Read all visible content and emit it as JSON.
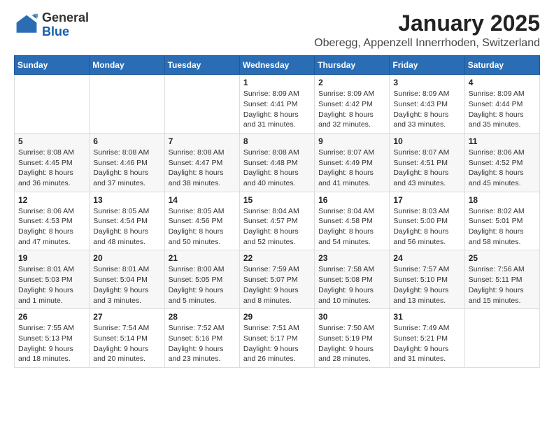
{
  "logo": {
    "general": "General",
    "blue": "Blue"
  },
  "header": {
    "month": "January 2025",
    "location": "Oberegg, Appenzell Innerrhoden, Switzerland"
  },
  "weekdays": [
    "Sunday",
    "Monday",
    "Tuesday",
    "Wednesday",
    "Thursday",
    "Friday",
    "Saturday"
  ],
  "weeks": [
    [
      {
        "day": "",
        "info": ""
      },
      {
        "day": "",
        "info": ""
      },
      {
        "day": "",
        "info": ""
      },
      {
        "day": "1",
        "info": "Sunrise: 8:09 AM\nSunset: 4:41 PM\nDaylight: 8 hours and 31 minutes."
      },
      {
        "day": "2",
        "info": "Sunrise: 8:09 AM\nSunset: 4:42 PM\nDaylight: 8 hours and 32 minutes."
      },
      {
        "day": "3",
        "info": "Sunrise: 8:09 AM\nSunset: 4:43 PM\nDaylight: 8 hours and 33 minutes."
      },
      {
        "day": "4",
        "info": "Sunrise: 8:09 AM\nSunset: 4:44 PM\nDaylight: 8 hours and 35 minutes."
      }
    ],
    [
      {
        "day": "5",
        "info": "Sunrise: 8:08 AM\nSunset: 4:45 PM\nDaylight: 8 hours and 36 minutes."
      },
      {
        "day": "6",
        "info": "Sunrise: 8:08 AM\nSunset: 4:46 PM\nDaylight: 8 hours and 37 minutes."
      },
      {
        "day": "7",
        "info": "Sunrise: 8:08 AM\nSunset: 4:47 PM\nDaylight: 8 hours and 38 minutes."
      },
      {
        "day": "8",
        "info": "Sunrise: 8:08 AM\nSunset: 4:48 PM\nDaylight: 8 hours and 40 minutes."
      },
      {
        "day": "9",
        "info": "Sunrise: 8:07 AM\nSunset: 4:49 PM\nDaylight: 8 hours and 41 minutes."
      },
      {
        "day": "10",
        "info": "Sunrise: 8:07 AM\nSunset: 4:51 PM\nDaylight: 8 hours and 43 minutes."
      },
      {
        "day": "11",
        "info": "Sunrise: 8:06 AM\nSunset: 4:52 PM\nDaylight: 8 hours and 45 minutes."
      }
    ],
    [
      {
        "day": "12",
        "info": "Sunrise: 8:06 AM\nSunset: 4:53 PM\nDaylight: 8 hours and 47 minutes."
      },
      {
        "day": "13",
        "info": "Sunrise: 8:05 AM\nSunset: 4:54 PM\nDaylight: 8 hours and 48 minutes."
      },
      {
        "day": "14",
        "info": "Sunrise: 8:05 AM\nSunset: 4:56 PM\nDaylight: 8 hours and 50 minutes."
      },
      {
        "day": "15",
        "info": "Sunrise: 8:04 AM\nSunset: 4:57 PM\nDaylight: 8 hours and 52 minutes."
      },
      {
        "day": "16",
        "info": "Sunrise: 8:04 AM\nSunset: 4:58 PM\nDaylight: 8 hours and 54 minutes."
      },
      {
        "day": "17",
        "info": "Sunrise: 8:03 AM\nSunset: 5:00 PM\nDaylight: 8 hours and 56 minutes."
      },
      {
        "day": "18",
        "info": "Sunrise: 8:02 AM\nSunset: 5:01 PM\nDaylight: 8 hours and 58 minutes."
      }
    ],
    [
      {
        "day": "19",
        "info": "Sunrise: 8:01 AM\nSunset: 5:03 PM\nDaylight: 9 hours and 1 minute."
      },
      {
        "day": "20",
        "info": "Sunrise: 8:01 AM\nSunset: 5:04 PM\nDaylight: 9 hours and 3 minutes."
      },
      {
        "day": "21",
        "info": "Sunrise: 8:00 AM\nSunset: 5:05 PM\nDaylight: 9 hours and 5 minutes."
      },
      {
        "day": "22",
        "info": "Sunrise: 7:59 AM\nSunset: 5:07 PM\nDaylight: 9 hours and 8 minutes."
      },
      {
        "day": "23",
        "info": "Sunrise: 7:58 AM\nSunset: 5:08 PM\nDaylight: 9 hours and 10 minutes."
      },
      {
        "day": "24",
        "info": "Sunrise: 7:57 AM\nSunset: 5:10 PM\nDaylight: 9 hours and 13 minutes."
      },
      {
        "day": "25",
        "info": "Sunrise: 7:56 AM\nSunset: 5:11 PM\nDaylight: 9 hours and 15 minutes."
      }
    ],
    [
      {
        "day": "26",
        "info": "Sunrise: 7:55 AM\nSunset: 5:13 PM\nDaylight: 9 hours and 18 minutes."
      },
      {
        "day": "27",
        "info": "Sunrise: 7:54 AM\nSunset: 5:14 PM\nDaylight: 9 hours and 20 minutes."
      },
      {
        "day": "28",
        "info": "Sunrise: 7:52 AM\nSunset: 5:16 PM\nDaylight: 9 hours and 23 minutes."
      },
      {
        "day": "29",
        "info": "Sunrise: 7:51 AM\nSunset: 5:17 PM\nDaylight: 9 hours and 26 minutes."
      },
      {
        "day": "30",
        "info": "Sunrise: 7:50 AM\nSunset: 5:19 PM\nDaylight: 9 hours and 28 minutes."
      },
      {
        "day": "31",
        "info": "Sunrise: 7:49 AM\nSunset: 5:21 PM\nDaylight: 9 hours and 31 minutes."
      },
      {
        "day": "",
        "info": ""
      }
    ]
  ]
}
